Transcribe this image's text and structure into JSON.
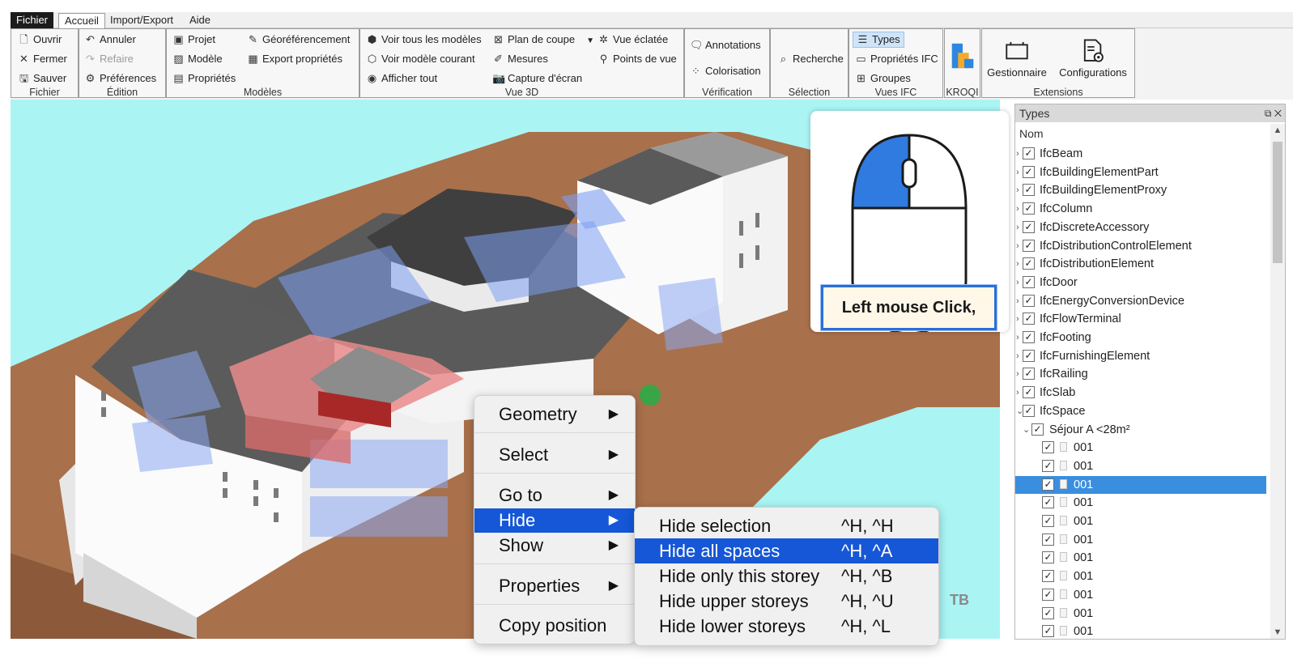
{
  "menubar": {
    "tabs": [
      {
        "label": "Fichier"
      },
      {
        "label": "Accueil"
      },
      {
        "label": "Import/Export"
      },
      {
        "label": "Aide"
      }
    ]
  },
  "ribbon": {
    "fichier": {
      "group": "Fichier",
      "open": "Ouvrir",
      "close": "Fermer",
      "save": "Sauver"
    },
    "edition": {
      "group": "Édition",
      "undo": "Annuler",
      "redo": "Refaire",
      "prefs": "Préférences"
    },
    "modeles": {
      "group": "Modèles",
      "project": "Projet",
      "model": "Modèle",
      "properties": "Propriétés",
      "georef": "Géoréférencement",
      "export_props": "Export propriétés"
    },
    "vue3d": {
      "group": "Vue 3D",
      "all_models": "Voir tous les modèles",
      "current_model": "Voir modèle courant",
      "show_all": "Afficher tout",
      "section": "Plan de coupe",
      "measures": "Mesures",
      "screenshot": "Capture d'écran",
      "exploded": "Vue éclatée",
      "viewpoints": "Points de vue"
    },
    "verification": {
      "group": "Vérification",
      "annotations": "Annotations",
      "colorize": "Colorisation"
    },
    "selection": {
      "group": "Sélection",
      "search": "Recherche"
    },
    "vues_ifc": {
      "group": "Vues IFC",
      "types": "Types",
      "ifc_props": "Propriétés IFC",
      "groups": "Groupes"
    },
    "kroqi": {
      "label": "KROQI"
    },
    "extensions": {
      "group": "Extensions",
      "manager": "Gestionnaire",
      "configs": "Configurations"
    }
  },
  "tooltip": {
    "caption": "Left mouse Click,"
  },
  "context_menu": {
    "items": [
      {
        "label": "Geometry",
        "arrow": "▶"
      },
      {
        "label": "Select",
        "arrow": "▶"
      },
      {
        "label": "Go to",
        "arrow": "▶"
      },
      {
        "label": "Hide",
        "arrow": "▶"
      },
      {
        "label": "Show",
        "arrow": "▶"
      },
      {
        "label": "Properties",
        "arrow": "▶"
      },
      {
        "label": "Copy position"
      }
    ]
  },
  "hide_submenu": {
    "items": [
      {
        "label": "Hide selection",
        "shortcut": "^H, ^H"
      },
      {
        "label": "Hide all spaces",
        "shortcut": "^H, ^A"
      },
      {
        "label": "Hide only this storey",
        "shortcut": "^H, ^B"
      },
      {
        "label": "Hide upper storeys",
        "shortcut": "^H, ^U"
      },
      {
        "label": "Hide lower storeys",
        "shortcut": "^H, ^L"
      }
    ]
  },
  "watermark": "TB",
  "types_panel": {
    "title": "Types",
    "column": "Nom",
    "types": [
      "IfcBeam",
      "IfcBuildingElementPart",
      "IfcBuildingElementProxy",
      "IfcColumn",
      "IfcDiscreteAccessory",
      "IfcDistributionControlElement",
      "IfcDistributionElement",
      "IfcDoor",
      "IfcEnergyConversionDevice",
      "IfcFlowTerminal",
      "IfcFooting",
      "IfcFurnishingElement",
      "IfcRailing",
      "IfcSlab",
      "IfcSpace"
    ],
    "space_group": "Séjour A <28m²",
    "spaces": [
      "001",
      "001",
      "001",
      "001",
      "001",
      "001",
      "001",
      "001",
      "001",
      "001",
      "001"
    ],
    "selected_index": 2
  },
  "colors": {
    "accent": "#1557d6",
    "selection": "#3a8ee0",
    "viewport": "#aaf4f4",
    "ground": "#a8704b"
  }
}
